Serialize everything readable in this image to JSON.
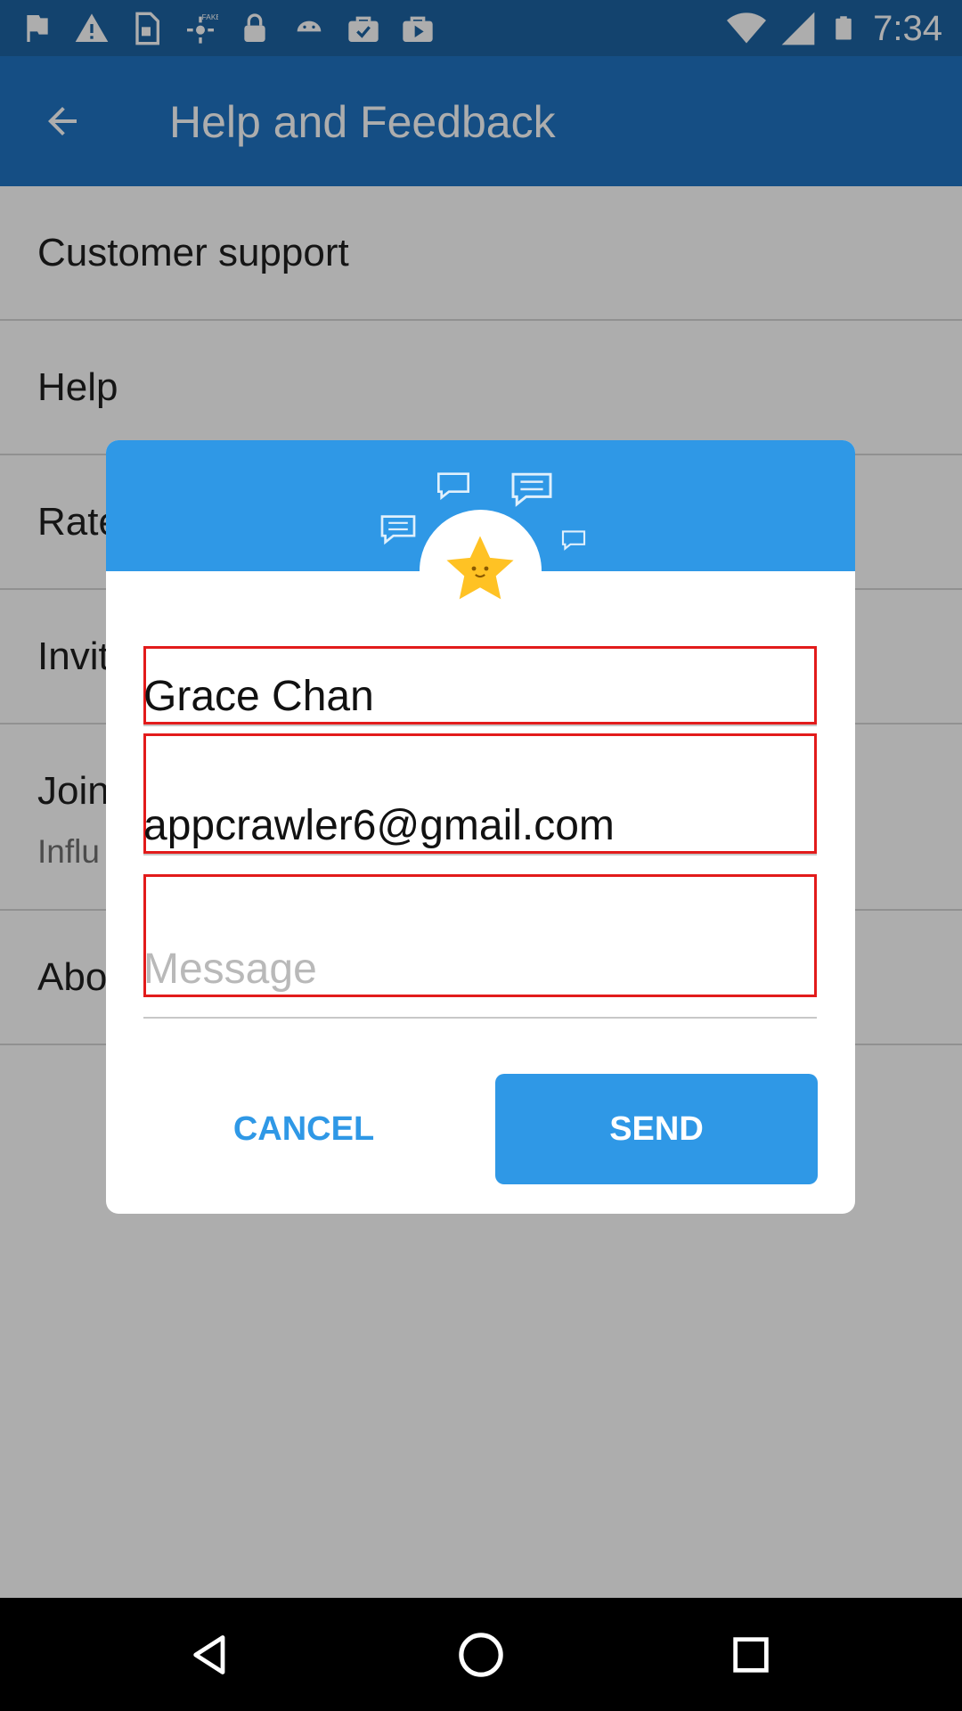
{
  "status_bar": {
    "time": "7:34",
    "left_icons": [
      "flag-icon",
      "warning-icon",
      "sim-card-icon",
      "fake-gps-icon",
      "lock-icon",
      "android-icon",
      "briefcase-check-icon",
      "briefcase-play-icon"
    ],
    "right_icons": [
      "wifi-icon",
      "signal-icon",
      "battery-icon"
    ]
  },
  "app_bar": {
    "title": "Help and Feedback",
    "back_icon": "arrow-back-icon",
    "color": "#1f74c3"
  },
  "list": {
    "items": [
      {
        "title": "Customer support"
      },
      {
        "title": "Help"
      },
      {
        "title": "Rate"
      },
      {
        "title": "Invite"
      },
      {
        "title": "Join",
        "subtitle": "Influ"
      },
      {
        "title": "About"
      }
    ]
  },
  "dialog": {
    "header_color": "#2f98e6",
    "badge_icon": "smiling-star-icon",
    "name_value": "Grace Chan",
    "email_value": "appcrawler6@gmail.com",
    "message_placeholder": "Message",
    "cancel_label": "CANCEL",
    "send_label": "SEND"
  },
  "nav_bar": {
    "icons": [
      "back-triangle-icon",
      "home-circle-icon",
      "recents-square-icon"
    ]
  },
  "colors": {
    "highlight_outline": "#e21b1b",
    "accent": "#2f98e6"
  }
}
